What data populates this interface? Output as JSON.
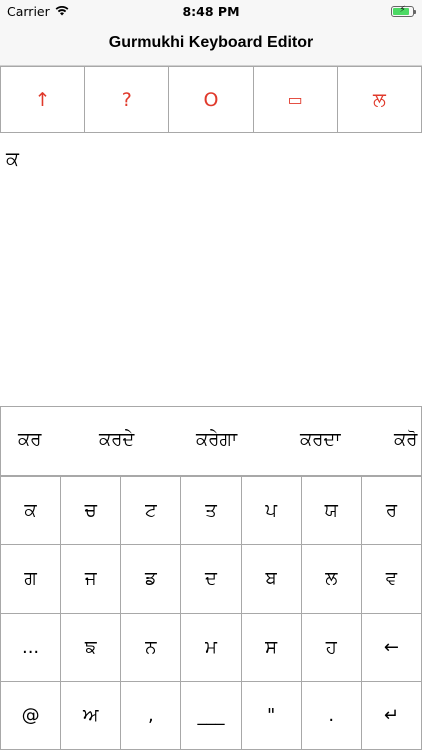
{
  "status_bar": {
    "carrier": "Carrier",
    "time": "8:48 PM",
    "battery_level": 0.85,
    "wifi_icon": "wifi-icon",
    "battery_icon": "battery-charging-icon"
  },
  "nav": {
    "title": "Gurmukhi Keyboard Editor"
  },
  "toolbar": {
    "accent_color": "#e0392b",
    "buttons": [
      {
        "label": "↑",
        "icon": "arrow-up-icon"
      },
      {
        "label": "?",
        "icon": "question-icon"
      },
      {
        "label": "O",
        "icon": "circle-icon"
      },
      {
        "label": "▭",
        "icon": "rounded-rect-icon"
      },
      {
        "label": "ਲ",
        "icon": "gurmukhi-la-icon"
      }
    ]
  },
  "editor": {
    "text": "ਕ"
  },
  "suggestions": [
    "ਕਰ",
    "ਕਰਦੇ",
    "ਕਰੇਗਾ",
    "ਕਰਦਾ",
    "ਕਰੋ"
  ],
  "keyboard": {
    "rows": [
      [
        "ਕ",
        "ਚ",
        "ਟ",
        "ਤ",
        "ਪ",
        "ਯ",
        "ਰ"
      ],
      [
        "ਗ",
        "ਜ",
        "ਡ",
        "ਦ",
        "ਬ",
        "ਲ",
        "ਵ"
      ],
      [
        "...",
        "ਙ",
        "ਨ",
        "ਮ",
        "ਸ",
        "ਹ",
        "←"
      ],
      [
        "@",
        "ਅ",
        ",",
        "___",
        "\"",
        ".",
        "↵"
      ]
    ]
  }
}
